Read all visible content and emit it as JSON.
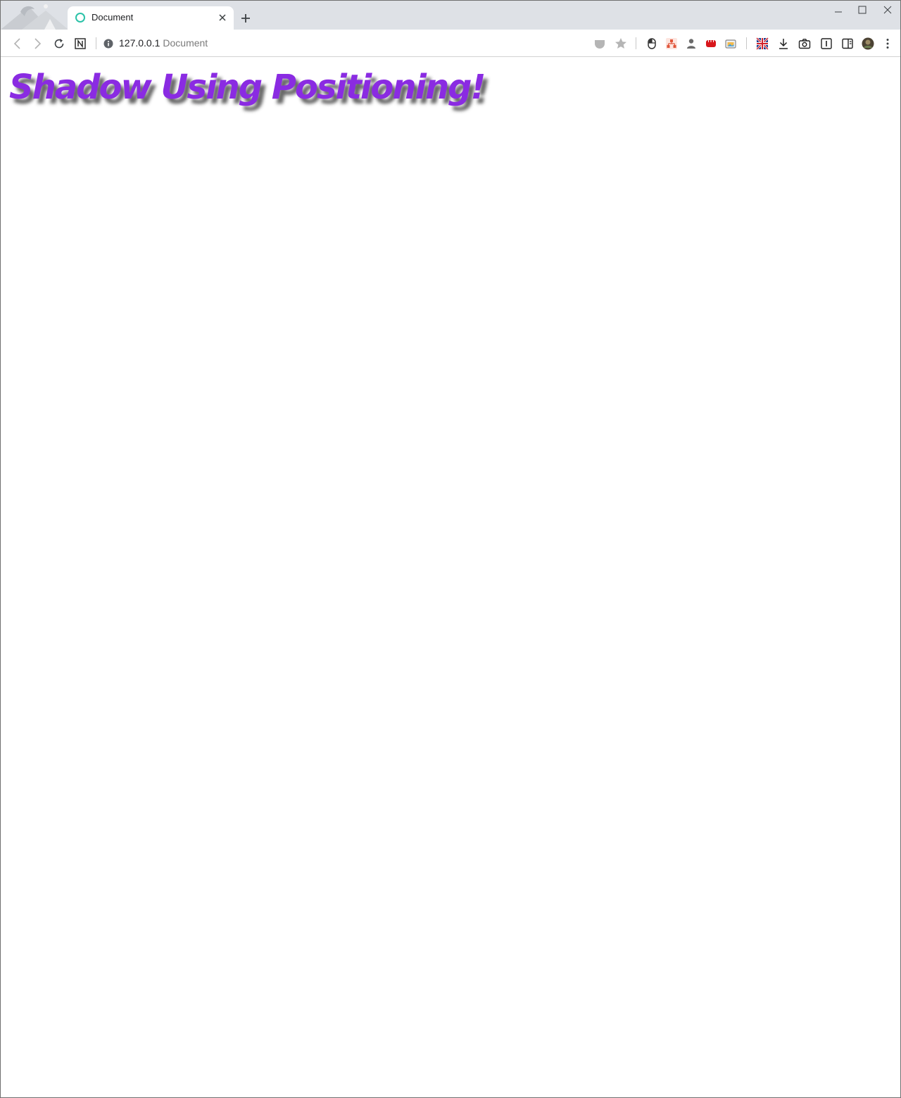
{
  "browser": {
    "tab": {
      "title": "Document"
    },
    "address_bar": {
      "host": "127.0.0.1",
      "page_title": "Document"
    }
  },
  "page": {
    "headline": "Shadow Using Positioning!"
  },
  "colors": {
    "headline": "#8a2be2",
    "tab_favicon": "#2bc2a8",
    "tabstrip_bg": "#dee1e6"
  }
}
